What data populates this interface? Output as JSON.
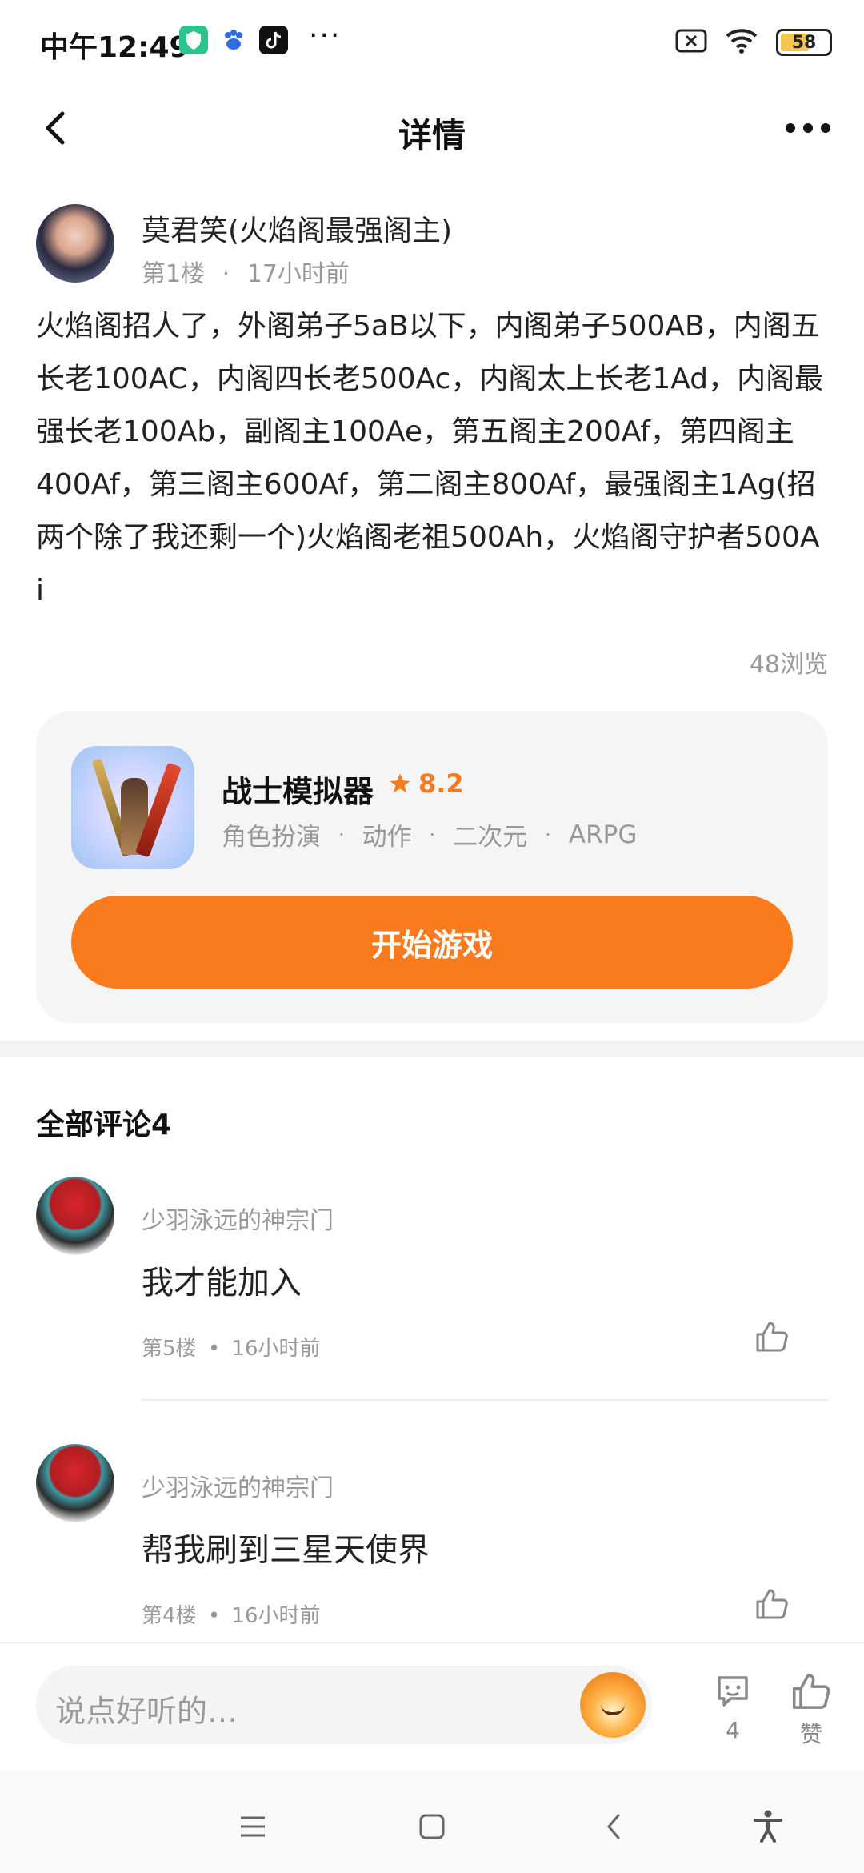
{
  "status_bar": {
    "time": "中午12:49",
    "dots": "···",
    "battery": "58"
  },
  "header": {
    "title": "详情"
  },
  "post": {
    "author": "莫君笑(火焰阁最强阁主)",
    "floor": "第1楼",
    "time": "17小时前",
    "content": "火焰阁招人了，外阁弟子5aB以下，内阁弟子500AB，内阁五长老100AC，内阁四长老500Ac，内阁太上长老1Ad，内阁最强长老100Ab，副阁主100Ae，第五阁主200Af，第四阁主400Af，第三阁主600Af，第二阁主800Af，最强阁主1Ag(招两个除了我还剩一个)火焰阁老祖500Ah，火焰阁守护者500A i",
    "views": "48浏览"
  },
  "game_card": {
    "name": "战士模拟器",
    "rating": "8.2",
    "tags": [
      "角色扮演",
      "动作",
      "二次元",
      "ARPG"
    ],
    "play_button": "开始游戏"
  },
  "comments": {
    "title": "全部评论4",
    "items": [
      {
        "user": "少羽泳远的神宗门",
        "text": " 我才能加入",
        "floor": "第5楼",
        "time": "16小时前"
      },
      {
        "user": "少羽泳远的神宗门",
        "text": "帮我刷到三星天使界",
        "floor": "第4楼",
        "time": "16小时前"
      }
    ]
  },
  "bottom_bar": {
    "placeholder": "说点好听的…",
    "comment_count": "4",
    "like_label": "赞"
  },
  "colors": {
    "accent": "#fa7a1e",
    "rating": "#f47b20",
    "muted": "#999999"
  }
}
